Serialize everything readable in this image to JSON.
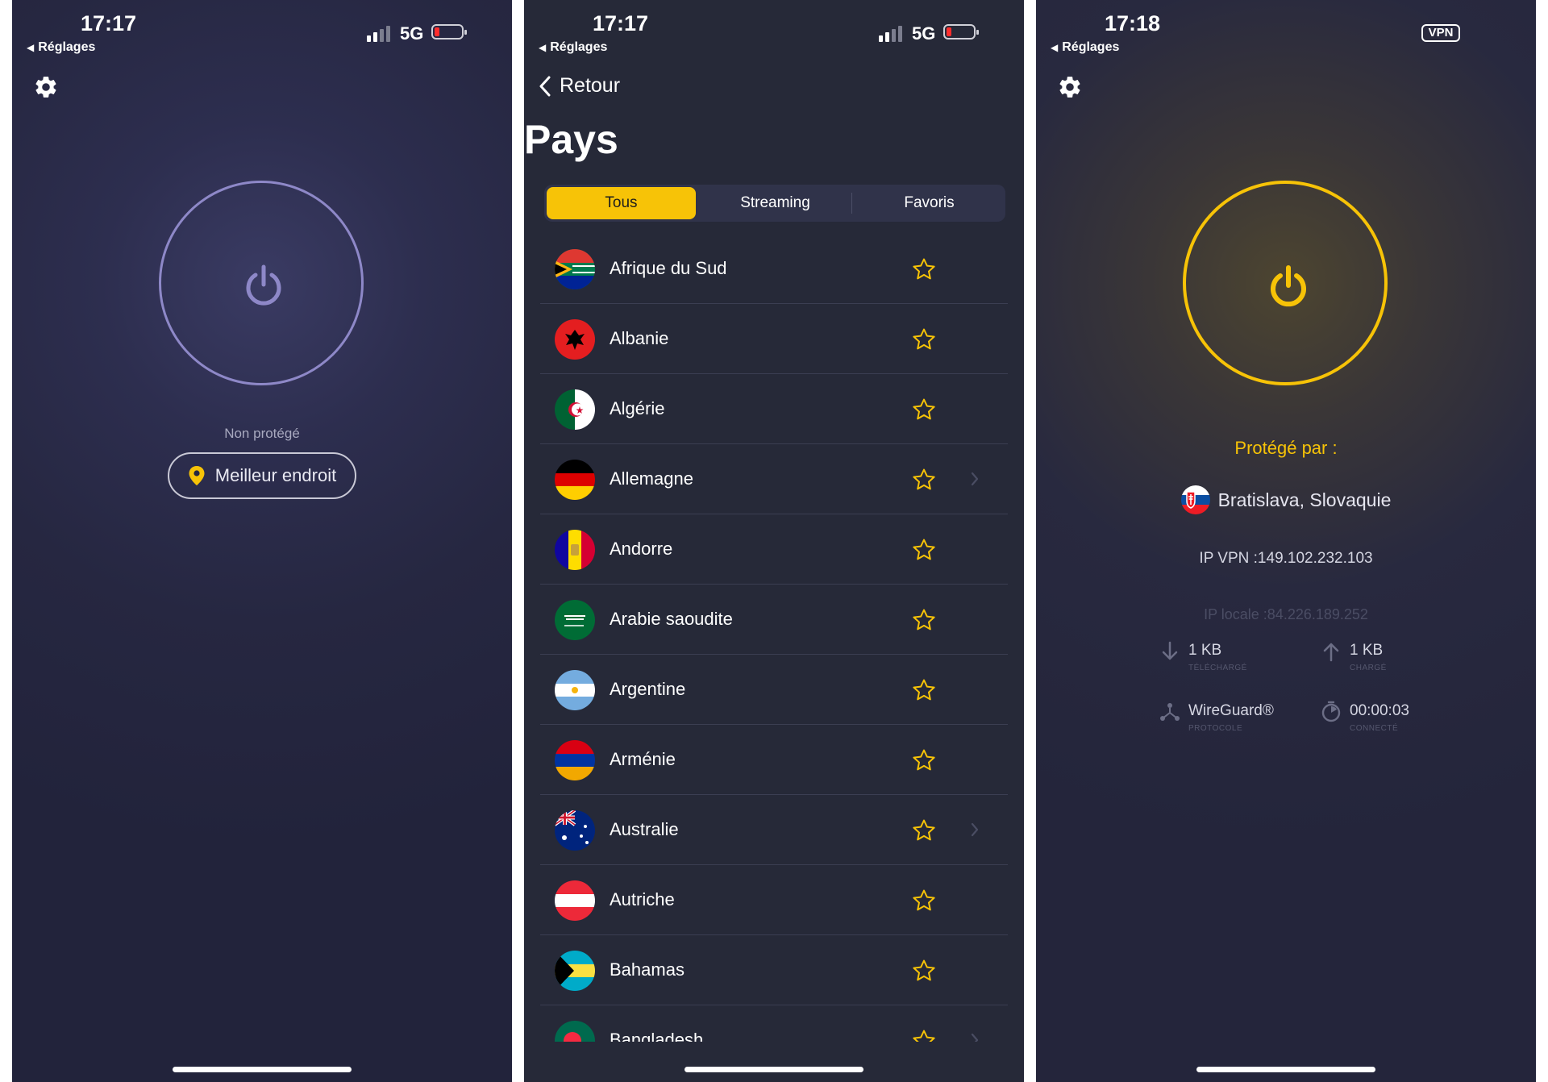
{
  "colors": {
    "accent": "#f7c307",
    "ring_off": "#8e88c8",
    "battery_low": "#ff2d2d"
  },
  "screen_off": {
    "status_bar": {
      "time": "17:17",
      "back": "Réglages",
      "network": "5G"
    },
    "settings_icon": "gear-icon",
    "status": "Non protégé",
    "location_button": "Meilleur endroit"
  },
  "countries_screen": {
    "status_bar": {
      "time": "17:17",
      "back": "Réglages",
      "network": "5G"
    },
    "back_label": "Retour",
    "title": "Pays",
    "tabs": [
      {
        "label": "Tous",
        "active": true
      },
      {
        "label": "Streaming",
        "active": false
      },
      {
        "label": "Favoris",
        "active": false
      }
    ],
    "countries": [
      {
        "name": "Afrique du Sud",
        "has_chevron": false
      },
      {
        "name": "Albanie",
        "has_chevron": false
      },
      {
        "name": "Algérie",
        "has_chevron": false
      },
      {
        "name": "Allemagne",
        "has_chevron": true
      },
      {
        "name": "Andorre",
        "has_chevron": false
      },
      {
        "name": "Arabie saoudite",
        "has_chevron": false
      },
      {
        "name": "Argentine",
        "has_chevron": false
      },
      {
        "name": "Arménie",
        "has_chevron": false
      },
      {
        "name": "Australie",
        "has_chevron": true
      },
      {
        "name": "Autriche",
        "has_chevron": false
      },
      {
        "name": "Bahamas",
        "has_chevron": false
      },
      {
        "name": "Bangladesh",
        "has_chevron": true
      }
    ]
  },
  "screen_on": {
    "status_bar": {
      "time": "17:18",
      "back": "Réglages",
      "vpn_badge": "VPN"
    },
    "settings_icon": "gear-icon",
    "protected_label": "Protégé par :",
    "location": "Bratislava, Slovaquie",
    "vpn_ip": "IP VPN :149.102.232.103",
    "local_ip": "IP locale :84.226.189.252",
    "stats": {
      "download": {
        "value": "1 KB",
        "caption": "TÉLÉCHARGÉ",
        "icon": "download-arrow-icon"
      },
      "upload": {
        "value": "1 KB",
        "caption": "CHARGÉ",
        "icon": "upload-arrow-icon"
      },
      "protocol": {
        "value": "WireGuard®",
        "caption": "PROTOCOLE",
        "icon": "protocol-icon"
      },
      "duration": {
        "value": "00:00:03",
        "caption": "CONNECTÉ",
        "icon": "timer-icon"
      }
    }
  }
}
